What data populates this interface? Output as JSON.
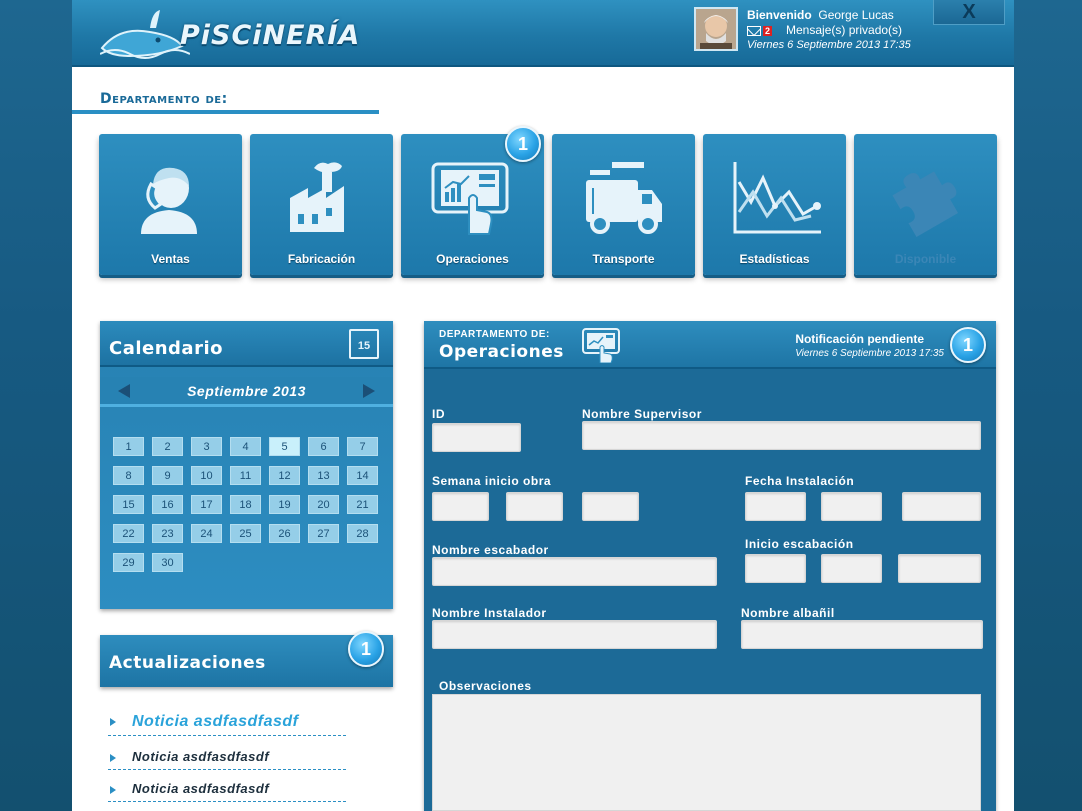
{
  "app": {
    "logo_text": "PiSCiNERÍA"
  },
  "header": {
    "welcome_label": "Bienvenido",
    "user_name": "George Lucas",
    "message_count": "2",
    "messages_label": "Mensaje(s) privado(s)",
    "datetime": "Viernes 6 Septiembre 2013 17:35",
    "close_label": "X"
  },
  "departments": {
    "title": "Departamento de:",
    "tiles": [
      {
        "label": "Ventas",
        "icon": "phone-person-icon",
        "badge": null
      },
      {
        "label": "Fabricación",
        "icon": "factory-icon",
        "badge": null
      },
      {
        "label": "Operaciones",
        "icon": "tablet-chart-icon",
        "badge": "1"
      },
      {
        "label": "Transporte",
        "icon": "truck-icon",
        "badge": null
      },
      {
        "label": "Estadísticas",
        "icon": "line-chart-icon",
        "badge": null
      },
      {
        "label": "Disponible",
        "icon": "puzzle-icon",
        "badge": null,
        "disabled": true
      }
    ]
  },
  "calendar": {
    "title": "Calendario",
    "icon_day": "15",
    "month": "Septiembre 2013",
    "days": [
      "1",
      "2",
      "3",
      "4",
      "5",
      "6",
      "7",
      "8",
      "9",
      "10",
      "11",
      "12",
      "13",
      "14",
      "15",
      "16",
      "17",
      "18",
      "19",
      "20",
      "21",
      "22",
      "23",
      "24",
      "25",
      "26",
      "27",
      "28",
      "29",
      "30"
    ],
    "today": "5"
  },
  "updates": {
    "title": "Actualizaciones",
    "badge": "1",
    "items": [
      "Noticia asdfasdfasdf",
      "Noticia asdfasdfasdf",
      "Noticia asdfasdfasdf"
    ]
  },
  "form": {
    "dept_small": "DEPARTAMENTO DE:",
    "dept_name": "Operaciones",
    "notification": "Notificación pendiente",
    "notification_date": "Viernes 6 Septiembre 2013 17:35",
    "notification_badge": "1",
    "labels": {
      "id": "ID",
      "supervisor": "Nombre Supervisor",
      "semana": "Semana inicio obra",
      "fecha_instalacion": "Fecha Instalación",
      "escabador": "Nombre escabador",
      "inicio_escabacion": "Inicio escabación",
      "instalador": "Nombre Instalador",
      "albanil": "Nombre albañil",
      "observaciones": "Observaciones"
    }
  },
  "colors": {
    "brand_blue": "#1f78a7",
    "panel_blue": "#1c6a97",
    "badge_blue": "#2aa3e6"
  }
}
